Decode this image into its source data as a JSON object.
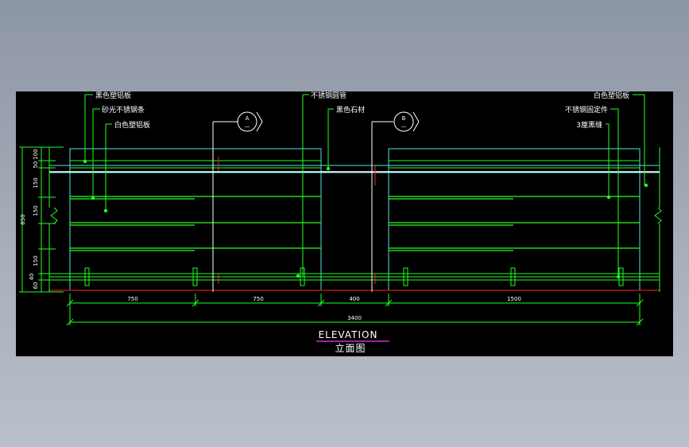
{
  "drawing": {
    "callouts": {
      "black_aluminum": "黑色塑铝板",
      "brushed_steel_strip": "砂光不锈钢条",
      "white_aluminum_left": "白色塑铝板",
      "steel_round_tube": "不锈钢圆管",
      "black_stone": "黑色石材",
      "white_aluminum_right": "白色塑铝板",
      "steel_fixing": "不锈钢固定件",
      "black_seam": "3厘黑缝"
    },
    "section_a": {
      "letter": "A",
      "sub": "—"
    },
    "section_b": {
      "letter": "B",
      "sub": "—"
    },
    "dims_bottom": [
      "750",
      "750",
      "400",
      "1500"
    ],
    "dim_total": "3400",
    "dims_left": [
      "100",
      "50",
      "150",
      "150",
      "150",
      "40",
      "60"
    ],
    "dim_left_total": "850",
    "title": "ELEVATION",
    "subtitle": "立面图"
  },
  "colors": {
    "background": "#000000",
    "green": "#22ff22",
    "cyan": "#55e0e0",
    "white": "#ffffff",
    "red": "#ff2222",
    "magenta": "#ff33ff"
  }
}
